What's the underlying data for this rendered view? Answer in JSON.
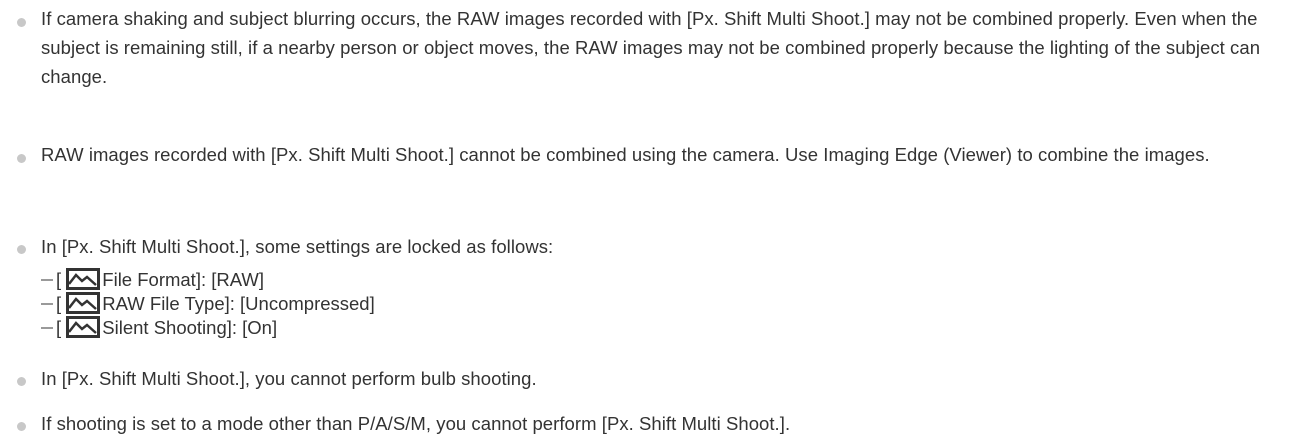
{
  "notes": [
    "If camera shaking and subject blurring occurs, the RAW images recorded with [Px. Shift Multi Shoot.] may not be combined properly. Even when the subject is remaining still, if a nearby person or object moves, the RAW images may not be combined properly because the lighting of the subject can change.",
    "RAW images recorded with [Px. Shift Multi Shoot.] cannot be combined using the camera. Use Imaging Edge (Viewer) to combine the images.",
    "In [Px. Shift Multi Shoot.], some settings are locked as follows:",
    "In [Px. Shift Multi Shoot.], you cannot perform bulb shooting.",
    "If shooting is set to a mode other than P/A/S/M, you cannot perform [Px. Shift Multi Shoot.]."
  ],
  "locked_settings": [
    {
      "open": "[",
      "icon": "still-image-icon",
      "text": "File Format]: [RAW]"
    },
    {
      "open": "[",
      "icon": "still-image-icon",
      "text": "RAW File Type]: [Uncompressed]"
    },
    {
      "open": "[",
      "icon": "still-image-icon",
      "text": "Silent Shooting]: [On]"
    }
  ],
  "colors": {
    "text": "#333333",
    "bullet": "#c8c8c8",
    "dash": "#9a9a9a",
    "icon": "#333333"
  }
}
